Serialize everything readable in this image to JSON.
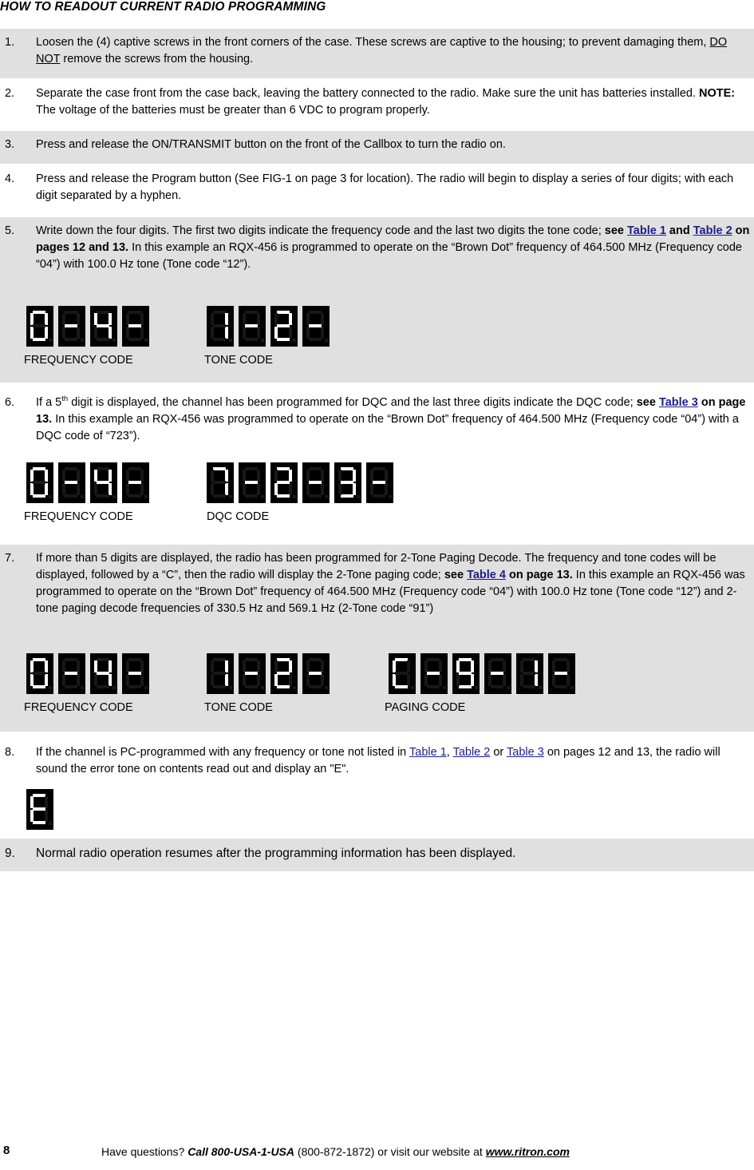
{
  "document": {
    "title": "HOW TO READOUT CURRENT RADIO PROGRAMMING",
    "page_number": "8"
  },
  "steps": [
    {
      "number": "1.",
      "shaded": true,
      "text_parts": {
        "p1": "Loosen the (4) captive screws in the front corners of the case.  These screws are captive to the housing; to prevent damaging them, ",
        "underlined": "DO NOT",
        "p2": " remove the screws from the housing."
      }
    },
    {
      "number": "2.",
      "shaded": false,
      "text_parts": {
        "p1": "Separate the case front from the case back, leaving the battery connected to the radio.  Make sure the unit has batteries installed.  ",
        "bold": "NOTE:",
        "p2": "  The voltage of the batteries must be greater than 6 VDC to program properly."
      }
    },
    {
      "number": "3.",
      "shaded": true,
      "text_parts": {
        "p1": "Press and release the ON/TRANSMIT button on the front of the Callbox to turn the radio on."
      }
    },
    {
      "number": "4.",
      "shaded": false,
      "text_parts": {
        "p1": "Press and release the Program button (See FIG-1 on page 3 for location).  The radio will begin to display a series of four digits; with each digit separated by a hyphen."
      }
    },
    {
      "number": "5.",
      "shaded": true,
      "text_parts": {
        "p1": "Write down the four digits. The first two digits indicate the frequency code and the last two digits the tone code; ",
        "bold1": "see ",
        "link1": "Table 1",
        "bold2": " and ",
        "link2": "Table 2",
        "bold3": " on pages 12 and 13.",
        "p2": "   In this example an RQX-456 is programmed to operate on the “Brown Dot” frequency of 464.500 MHz (Frequency code “04”) with 100.0 Hz tone (Tone code “12”)."
      }
    },
    {
      "number": "6.",
      "shaded": false,
      "text_parts": {
        "p0": "If a 5",
        "sup": "th",
        "p1": " digit is displayed, the channel has been programmed for DQC and the last three digits indicate the DQC code; ",
        "bold1": "see ",
        "link1": "Table 3",
        "bold2": " on page 13.",
        "p2": "  In this example an RQX-456 was programmed to operate on the “Brown Dot” frequency of 464.500 MHz (Frequency code “04”) with a DQC code of “723”)."
      }
    },
    {
      "number": "7.",
      "shaded": true,
      "text_parts": {
        "p1": "If more than 5 digits are displayed, the radio has been programmed for 2-Tone Paging Decode. The frequency and tone codes will be displayed, followed by a “C”, then the radio will display the 2-Tone paging code; ",
        "bold1": "see ",
        "link1": "Table 4",
        "bold2": " on page 13.",
        "p2": "     In this example an RQX-456 was programmed to operate on the “Brown Dot” frequency of 464.500 MHz (Frequency code “04”) with 100.0 Hz tone (Tone code “12”) and 2-tone paging decode frequencies of 330.5 Hz and 569.1 Hz (2-Tone code “91”)"
      }
    },
    {
      "number": "8.",
      "shaded": false,
      "text_parts": {
        "p1": "If the channel is PC-programmed with any frequency or tone not listed in ",
        "link1": "Table 1",
        "p2": ", ",
        "link2": "Table 2",
        "p3": " or ",
        "link3": "Table 3",
        "p4": " on pages 12 and 13, the radio will sound the error tone on contents read out and display an \"E\"."
      }
    },
    {
      "number": "9.",
      "shaded": true,
      "text_parts": {
        "p1": "Normal radio operation resumes after the programming information has been displayed."
      }
    }
  ],
  "displays": {
    "example5": {
      "groups": [
        {
          "label": "FREQUENCY CODE",
          "chars": [
            "0",
            "-",
            "4",
            "-"
          ]
        },
        {
          "label": "TONE CODE",
          "chars": [
            "1",
            "-",
            "2",
            "-"
          ]
        }
      ]
    },
    "example6": {
      "groups": [
        {
          "label": "FREQUENCY CODE",
          "chars": [
            "0",
            "-",
            "4",
            "-"
          ]
        },
        {
          "label": "DQC CODE",
          "chars": [
            "7",
            "-",
            "2",
            "-",
            "3",
            "-"
          ]
        }
      ]
    },
    "example7": {
      "groups": [
        {
          "label": "FREQUENCY CODE",
          "chars": [
            "0",
            "-",
            "4",
            "-"
          ]
        },
        {
          "label": "TONE CODE",
          "chars": [
            "1",
            "-",
            "2",
            "-"
          ]
        },
        {
          "label": "PAGING CODE",
          "chars": [
            "C",
            "-",
            "9",
            "-",
            "1",
            "-"
          ]
        }
      ]
    },
    "example8": {
      "groups": [
        {
          "label": "",
          "chars": [
            "E"
          ]
        }
      ]
    }
  },
  "footer": {
    "have_questions": "Have questions?  ",
    "call": "Call 800-USA-1-USA",
    "phone": " (800-872-1872) or visit our website at ",
    "website": "www.ritron.com"
  },
  "colors": {
    "shade": "#e0e0e0",
    "link": "#1f1f8c",
    "segment_on": "#ffffff",
    "segment_off": "#181818",
    "display_background": "#000000"
  }
}
